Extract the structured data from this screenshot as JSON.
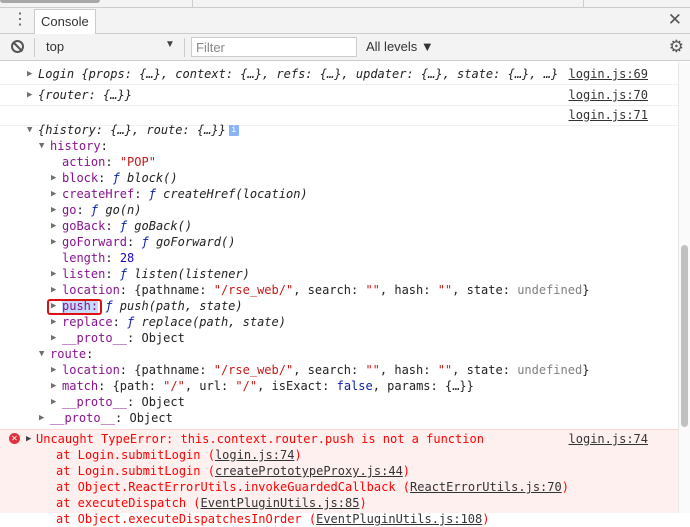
{
  "tabbar": {
    "tab": "Console",
    "menu_icon": "⋮",
    "close_icon": "✕"
  },
  "toolbar": {
    "context": "top",
    "filter_placeholder": "Filter",
    "levels": "All levels ▼",
    "settings_icon": "⚙"
  },
  "messages": [
    {
      "indent": 0,
      "arrow": "▶",
      "src": "login.js:69",
      "segs": [
        [
          "it p",
          "Login {props: {…}, context: {…}, refs: {…}, updater: {…}, state: {…}, …}"
        ]
      ]
    },
    {
      "indent": 0,
      "arrow": "▶",
      "src": "login.js:70",
      "segs": [
        [
          "it p",
          "{router: {…}}"
        ]
      ]
    },
    {
      "indent": 0,
      "arrow": "",
      "src": "login.js:71",
      "segs": []
    },
    {
      "indent": 0,
      "arrow": "▼",
      "info": "i",
      "segs": [
        [
          "it p",
          "{history: {…}, route: {…}}"
        ]
      ]
    },
    {
      "indent": 1,
      "arrow": "▼",
      "segs": [
        [
          "k",
          "history"
        ],
        [
          "p",
          ":"
        ]
      ]
    },
    {
      "indent": 2,
      "arrow": "",
      "segs": [
        [
          "k",
          "action"
        ],
        [
          "p",
          ": "
        ],
        [
          "s",
          "\"POP\""
        ]
      ]
    },
    {
      "indent": 2,
      "arrow": "▶",
      "segs": [
        [
          "k",
          "block"
        ],
        [
          "p",
          ": "
        ],
        [
          "f",
          "ƒ"
        ],
        [
          "it p",
          " block()"
        ]
      ]
    },
    {
      "indent": 2,
      "arrow": "▶",
      "segs": [
        [
          "k",
          "createHref"
        ],
        [
          "p",
          ": "
        ],
        [
          "f",
          "ƒ"
        ],
        [
          "it p",
          " createHref(location)"
        ]
      ]
    },
    {
      "indent": 2,
      "arrow": "▶",
      "segs": [
        [
          "k",
          "go"
        ],
        [
          "p",
          ": "
        ],
        [
          "f",
          "ƒ"
        ],
        [
          "it p",
          " go(n)"
        ]
      ]
    },
    {
      "indent": 2,
      "arrow": "▶",
      "segs": [
        [
          "k",
          "goBack"
        ],
        [
          "p",
          ": "
        ],
        [
          "f",
          "ƒ"
        ],
        [
          "it p",
          " goBack()"
        ]
      ]
    },
    {
      "indent": 2,
      "arrow": "▶",
      "segs": [
        [
          "k",
          "goForward"
        ],
        [
          "p",
          ": "
        ],
        [
          "f",
          "ƒ"
        ],
        [
          "it p",
          " goForward()"
        ]
      ]
    },
    {
      "indent": 2,
      "arrow": "",
      "segs": [
        [
          "k",
          "length"
        ],
        [
          "p",
          ": "
        ],
        [
          "n",
          "28"
        ]
      ]
    },
    {
      "indent": 2,
      "arrow": "▶",
      "segs": [
        [
          "k",
          "listen"
        ],
        [
          "p",
          ": "
        ],
        [
          "f",
          "ƒ"
        ],
        [
          "it p",
          " listen(listener)"
        ]
      ]
    },
    {
      "indent": 2,
      "arrow": "▶",
      "segs": [
        [
          "k",
          "location"
        ],
        [
          "p",
          ": {pathname: "
        ],
        [
          "s",
          "\"/rse_web/\""
        ],
        [
          "p",
          ", search: "
        ],
        [
          "s",
          "\"\""
        ],
        [
          "p",
          ", hash: "
        ],
        [
          "s",
          "\"\""
        ],
        [
          "p",
          ", state: "
        ],
        [
          "g",
          "undefined"
        ],
        [
          "p",
          "}"
        ]
      ]
    },
    {
      "indent": 2,
      "arrow": "▶",
      "segs": [
        [
          "k hlbg",
          "push:"
        ],
        [
          "f",
          " ƒ"
        ],
        [
          "it p",
          " push(path, state)"
        ]
      ]
    },
    {
      "indent": 2,
      "arrow": "▶",
      "segs": [
        [
          "k",
          "replace"
        ],
        [
          "p",
          ": "
        ],
        [
          "f",
          "ƒ"
        ],
        [
          "it p",
          " replace(path, state)"
        ]
      ]
    },
    {
      "indent": 2,
      "arrow": "▶",
      "segs": [
        [
          "k",
          "__proto__"
        ],
        [
          "p",
          ": Object"
        ]
      ]
    },
    {
      "indent": 1,
      "arrow": "▼",
      "segs": [
        [
          "k",
          "route"
        ],
        [
          "p",
          ":"
        ]
      ]
    },
    {
      "indent": 2,
      "arrow": "▶",
      "segs": [
        [
          "k",
          "location"
        ],
        [
          "p",
          ": {pathname: "
        ],
        [
          "s",
          "\"/rse_web/\""
        ],
        [
          "p",
          ", search: "
        ],
        [
          "s",
          "\"\""
        ],
        [
          "p",
          ", hash: "
        ],
        [
          "s",
          "\"\""
        ],
        [
          "p",
          ", state: "
        ],
        [
          "g",
          "undefined"
        ],
        [
          "p",
          "}"
        ]
      ]
    },
    {
      "indent": 2,
      "arrow": "▶",
      "segs": [
        [
          "k",
          "match"
        ],
        [
          "p",
          ": {path: "
        ],
        [
          "s",
          "\"/\""
        ],
        [
          "p",
          ", url: "
        ],
        [
          "s",
          "\"/\""
        ],
        [
          "p",
          ", isExact: "
        ],
        [
          "kw",
          "false"
        ],
        [
          "p",
          ", params: {…}}"
        ]
      ]
    },
    {
      "indent": 2,
      "arrow": "▶",
      "segs": [
        [
          "k",
          "__proto__"
        ],
        [
          "p",
          ": Object"
        ]
      ]
    },
    {
      "indent": 1,
      "arrow": "▶",
      "segs": [
        [
          "k",
          "__proto__"
        ],
        [
          "p",
          ": Object"
        ]
      ]
    }
  ],
  "error": {
    "icon": "✕",
    "message": "Uncaught TypeError: this.context.router.push is not a function",
    "src": "login.js:74",
    "stack": [
      {
        "fn": "at Login.submitLogin (",
        "link": "login.js:74"
      },
      {
        "fn": "at Login.submitLogin (",
        "link": "createPrototypeProxy.js:44"
      },
      {
        "fn": "at Object.ReactErrorUtils.invokeGuardedCallback (",
        "link": "ReactErrorUtils.js:70"
      },
      {
        "fn": "at executeDispatch (",
        "link": "EventPluginUtils.js:85"
      },
      {
        "fn": "at Object.executeDispatchesInOrder (",
        "link": "EventPluginUtils.js:108"
      }
    ]
  }
}
